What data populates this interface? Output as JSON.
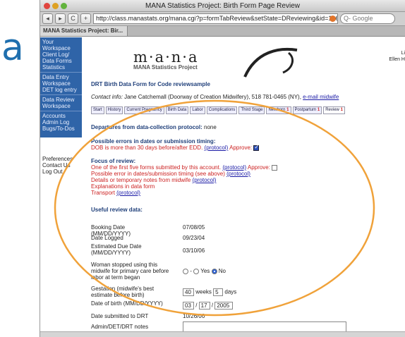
{
  "slide": {
    "letter": "a"
  },
  "window": {
    "title": "MANA Statistics Project: Birth Form Page Review"
  },
  "toolbar": {
    "back": "◂",
    "forward": "▸",
    "reload": "C",
    "add": "+",
    "url": "http://class.manastats.org/mana.cgi?p=formTabReview&setState=DReviewing&id=106",
    "search_placeholder": "Q- Google"
  },
  "browser_tab": {
    "label": "MANA Statistics Project: Bir..."
  },
  "sidebar": {
    "group1": [
      "Your Workspace",
      "Client Log/",
      "Data Forms",
      "Statistics"
    ],
    "group2": [
      "Data Entry",
      "Workspace",
      "DET log entry"
    ],
    "group3": [
      "Data Review",
      "Workspace"
    ],
    "group4": [
      "Accounts",
      "Admin Log",
      "Bugs/To-Dos"
    ],
    "lower": [
      "Preferences",
      "Contact Us",
      "Log Out"
    ]
  },
  "logo": {
    "word": "m·a·n·a",
    "sub": "MANA Statistics Project"
  },
  "topright": {
    "line1": "Li",
    "line2": "Ellen H"
  },
  "page": {
    "heading": "DRT Birth Data Form for Code reviewsample",
    "contact_label": "Contact info:",
    "contact_text": "Jane Catchemall (Doorway of Creation Midwifery), 518 781-0465 (NY),",
    "contact_link": "e-mail midwife"
  },
  "form_tabs": [
    {
      "label": "Start"
    },
    {
      "label": "History"
    },
    {
      "label": "Current Pregnancy"
    },
    {
      "label": "Birth Data"
    },
    {
      "label": "Labor"
    },
    {
      "label": "Complications"
    },
    {
      "label": "Third Stage"
    },
    {
      "label": "Newborn",
      "flag": "1"
    },
    {
      "label": "Postpartum",
      "flag": "1"
    },
    {
      "label": "Review",
      "flag": "1"
    }
  ],
  "departures": {
    "label": "Departures from data-collection protocol:",
    "value": "none"
  },
  "errors": {
    "label": "Possible errors in dates or submission timing:",
    "line": "DOB is more than 30 days before/after EDD.",
    "protocol": "(protocol)",
    "approve": "Approve:"
  },
  "focus": {
    "label": "Focus of review:",
    "line1": "One of the first five forms submitted by this account.",
    "line2": "Possible error in dates/submission timing (see above)",
    "line3": "Details or temporary notes from midwife",
    "line4": "Explanations in data form",
    "line5": "Transport",
    "protocol": "(protocol)",
    "approve": "Approve:"
  },
  "useful": {
    "label": "Useful review data:"
  },
  "review_data": {
    "booking_label": "Booking Date (MM/DD/YYYY)",
    "booking_value": "07/08/05",
    "logged_label": "Date Logged",
    "logged_value": "09/23/04",
    "due_label": "Estimated Due Date (MM/DD/YYYY)",
    "due_value": "03/10/06",
    "stopped_label": "Woman stopped using this midwife for primary care before labor at term began",
    "stopped_opt_dash": "-",
    "stopped_opt_yes": "Yes",
    "stopped_opt_no": "No",
    "gestation_label": "Gestation (midwife's best estimate before birth)",
    "gestation_weeks": "40",
    "weeks_word": "weeks",
    "gestation_days": "5",
    "days_word": "days",
    "dob_label": "Date of birth (MM/DD/YYYY)",
    "dob_mm": "03",
    "dob_dd": "17",
    "dob_yyyy": "2005",
    "submitted_label": "Date submitted to DRT",
    "submitted_value": "10/26/06",
    "notes_label": "Admin/DET/DRT notes"
  },
  "colors": {
    "sidebar": "#2f64a8",
    "oval": "#f0a23a",
    "error_red": "#cc2222"
  }
}
